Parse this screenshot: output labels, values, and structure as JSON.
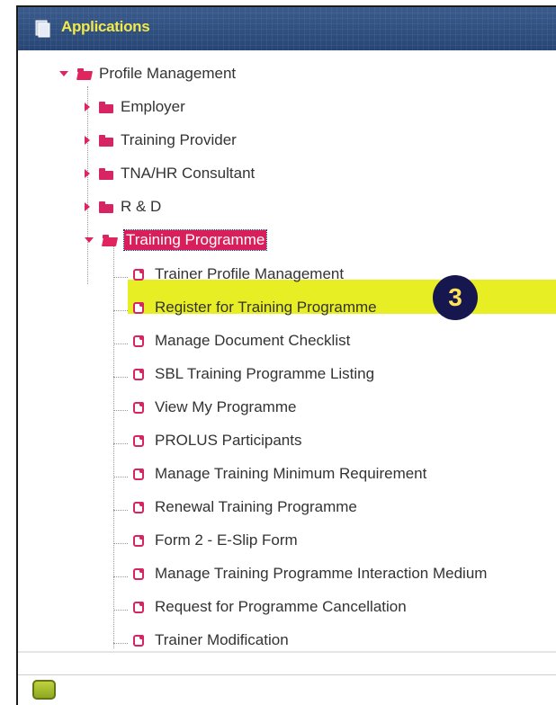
{
  "header": {
    "title": "Applications",
    "icon": "applications-icon"
  },
  "tree": {
    "root": {
      "label": "Profile Management",
      "expanded": true
    },
    "children": [
      {
        "label": "Employer",
        "expanded": false
      },
      {
        "label": "Training Provider",
        "expanded": false
      },
      {
        "label": "TNA/HR Consultant",
        "expanded": false
      },
      {
        "label": "R & D",
        "expanded": false
      },
      {
        "label": "Training Programme",
        "expanded": true,
        "selected": true
      }
    ],
    "leaves": [
      "Trainer Profile Management",
      "Register for Training Programme",
      "Manage Document Checklist",
      "SBL Training Programme Listing",
      "View My Programme",
      "PROLUS Participants",
      "Manage Training Minimum Requirement",
      "Renewal Training Programme",
      "Form 2 - E-Slip Form",
      "Manage Training Programme Interaction Medium",
      "Request for Programme Cancellation",
      "Trainer Modification"
    ]
  },
  "callout": {
    "number": "3"
  },
  "colors": {
    "header_bg": "#274675",
    "header_text": "#f2e94a",
    "accent": "#d62562",
    "highlight": "#e8ee24",
    "badge_bg": "#16174f"
  }
}
